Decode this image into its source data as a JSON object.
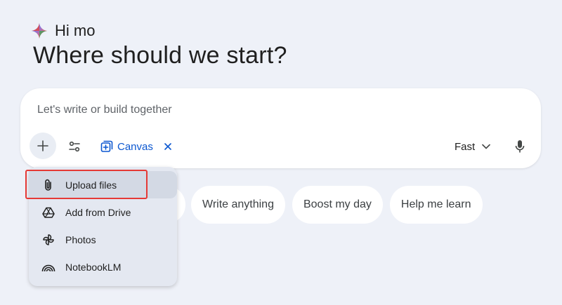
{
  "greeting": {
    "text": "Hi mo"
  },
  "headline": "Where should we start?",
  "composer": {
    "placeholder": "Let's write or build together",
    "value": "",
    "canvas_label": "Canvas",
    "mode_label": "Fast"
  },
  "chips": [
    {
      "label": "Write anything"
    },
    {
      "label": "Boost my day"
    },
    {
      "label": "Help me learn"
    }
  ],
  "menu": {
    "items": [
      {
        "label": "Upload files",
        "icon": "paperclip-icon"
      },
      {
        "label": "Add from Drive",
        "icon": "drive-icon"
      },
      {
        "label": "Photos",
        "icon": "photos-icon"
      },
      {
        "label": "NotebookLM",
        "icon": "notebooklm-icon"
      }
    ]
  },
  "colors": {
    "background": "#eef1f8",
    "accent_blue": "#0b57d0",
    "highlight_red": "#e53935"
  }
}
